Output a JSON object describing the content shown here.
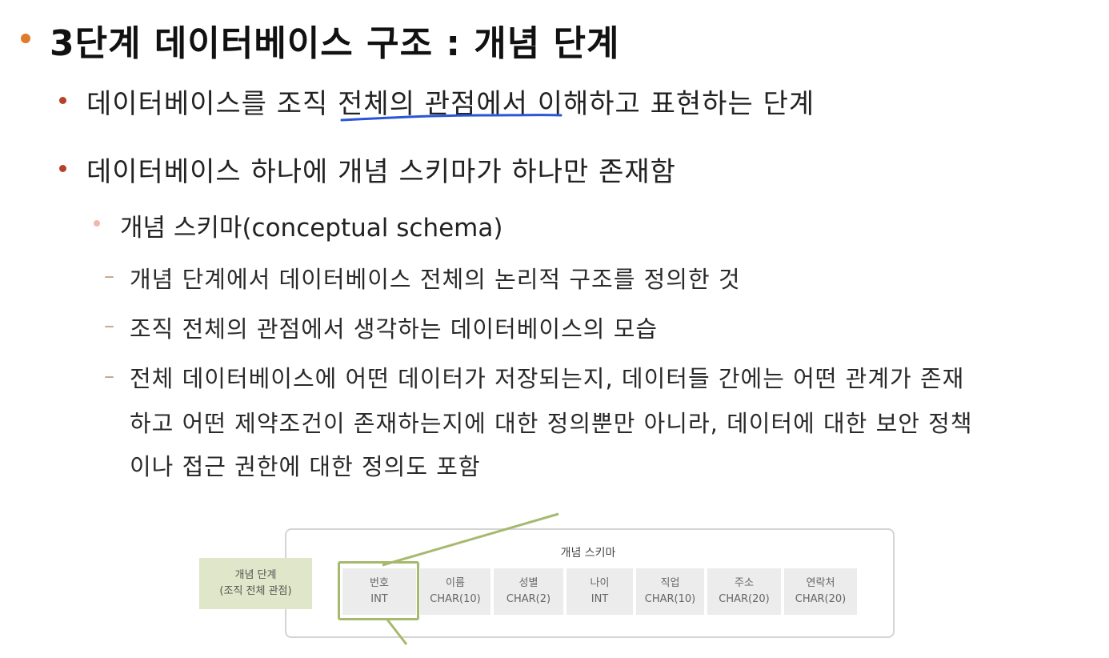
{
  "title": "3단계 데이터베이스 구조 : 개념 단계",
  "bullets": {
    "b1": "데이터베이스를 조직 전체의 관점에서 이해하고 표현하는 단계",
    "b2": "데이터베이스 하나에 개념 스키마가 하나만 존재함",
    "b3": "개념 스키마(conceptual schema)",
    "d1": "개념 단계에서 데이터베이스 전체의 논리적 구조를 정의한 것",
    "d2": "조직 전체의 관점에서 생각하는 데이터베이스의 모습",
    "d3_line1": "전체 데이터베이스에 어떤 데이터가 저장되는지, 데이터들 간에는 어떤 관계가 존재",
    "d3_line2": "하고 어떤 제약조건이 존재하는지에 대한 정의뿐만 아니라, 데이터에 대한 보안 정책",
    "d3_line3": "이나 접근 권한에 대한 정의도 포함"
  },
  "dash_glyph": "–",
  "diagram": {
    "schema_title": "개념 스키마",
    "level_label_line1": "개념 단계",
    "level_label_line2": "(조직 전체 관점)",
    "columns": [
      {
        "name": "번호",
        "type": "INT"
      },
      {
        "name": "이름",
        "type": "CHAR(10)"
      },
      {
        "name": "성별",
        "type": "CHAR(2)"
      },
      {
        "name": "나이",
        "type": "INT"
      },
      {
        "name": "직업",
        "type": "CHAR(10)"
      },
      {
        "name": "주소",
        "type": "CHAR(20)"
      },
      {
        "name": "연락처",
        "type": "CHAR(20)"
      }
    ]
  },
  "colors": {
    "title_bullet": "#e07a2c",
    "bullet": "#b5412a",
    "sub_bullet": "#f2b6b0",
    "dash": "#c2a37e",
    "underline": "#2a56d6",
    "highlight": "#a6b96e",
    "label_bg": "#dfe6c9",
    "cell_bg": "#ececec"
  }
}
